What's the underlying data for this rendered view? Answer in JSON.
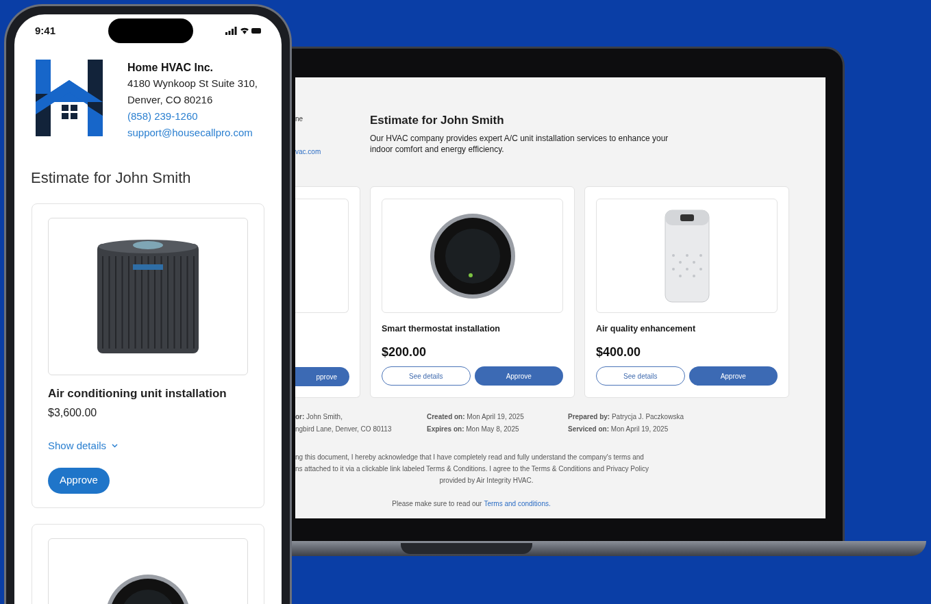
{
  "laptop": {
    "company_fragments": [
      {
        "text": "ne",
        "kind": "text"
      },
      {
        "text": "vac.com",
        "kind": "link"
      }
    ],
    "heading": "Estimate for John Smith",
    "description": "Our HVAC company provides expert A/C unit installation services to enhance your indoor comfort and energy efficiency.",
    "cards": [
      {
        "kind": "partial",
        "approve": "pprove"
      },
      {
        "kind": "full",
        "title": "Smart thermostat installation",
        "price": "$200.00",
        "details": "See details",
        "approve": "Approve"
      },
      {
        "kind": "full",
        "title": "Air quality enhancement",
        "price": "$400.00",
        "details": "See details",
        "approve": "Approve"
      }
    ],
    "meta_columns": [
      [
        "**or:** John Smith,",
        "ngbird Lane, Denver, CO 80113"
      ],
      [
        "**Created on:** Mon April 19, 2025",
        "**Expires on:** Mon May 8, 2025"
      ],
      [
        "**Prepared by:** Patrycja J. Paczkowska",
        "**Serviced on:** Mon April 19, 2025"
      ]
    ],
    "disclaimer": {
      "lines": [
        "ng this document, I hereby acknowledge that I have completely read and fully understand the company's terms and",
        "ns attached to it via a clickable link labeled Terms & Conditions. I agree to the Terms & Conditions and Privacy Policy"
      ],
      "last_line": "provided by Air Integrity HVAC."
    },
    "terms_note": {
      "text": "Please make sure to read our",
      "link": "Terms and conditions."
    }
  },
  "phone": {
    "status_bar": {
      "time": "9:41"
    },
    "company": {
      "name": "Home HVAC Inc.",
      "address_lines": [
        "4180 Wynkoop St Suite 310,",
        "Denver, CO 80216"
      ],
      "phone": "(858) 239-1260",
      "email": "support@housecallpro.com"
    },
    "heading": "Estimate for John Smith",
    "cards": [
      {
        "title": "Air conditioning unit installation",
        "price": "$3,600.00",
        "details": "Show details",
        "approve": "Approve"
      }
    ]
  }
}
